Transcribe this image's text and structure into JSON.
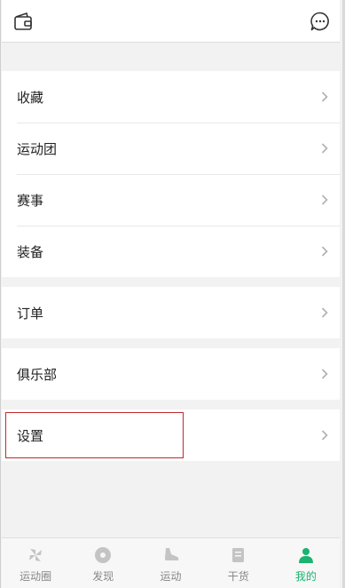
{
  "header": {
    "left_icon": "wallet-icon",
    "right_icon": "message-icon"
  },
  "sections": [
    {
      "items": [
        {
          "label": "收藏"
        },
        {
          "label": "运动团"
        },
        {
          "label": "赛事"
        },
        {
          "label": "装备"
        }
      ]
    },
    {
      "items": [
        {
          "label": "订单"
        }
      ]
    },
    {
      "items": [
        {
          "label": "俱乐部"
        }
      ]
    },
    {
      "items": [
        {
          "label": "设置"
        }
      ]
    }
  ],
  "tabbar": {
    "tabs": [
      {
        "label": "运动圈",
        "icon": "pinwheel-icon",
        "active": false
      },
      {
        "label": "发现",
        "icon": "disc-icon",
        "active": false
      },
      {
        "label": "运动",
        "icon": "shoe-icon",
        "active": false
      },
      {
        "label": "干货",
        "icon": "document-icon",
        "active": false
      },
      {
        "label": "我的",
        "icon": "person-icon",
        "active": true
      }
    ]
  },
  "colors": {
    "accent": "#1ab370",
    "highlight_border": "#c0282d"
  }
}
